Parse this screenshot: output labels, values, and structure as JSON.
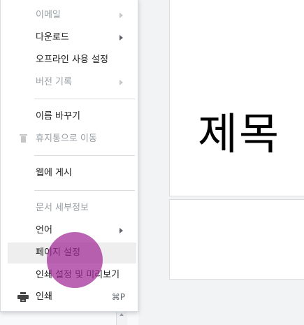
{
  "slide": {
    "title": "제목"
  },
  "menu": {
    "email": "이메일",
    "download": "다운로드",
    "offline": "오프라인 사용 설정",
    "version_history": "버전 기록",
    "rename": "이름 바꾸기",
    "move_to_trash": "휴지통으로 이동",
    "publish_web": "웹에 게시",
    "doc_details": "문서 세부정보",
    "language": "언어",
    "page_setup": "페이지 설정",
    "print_preview": "인쇄 설정 및 미리보기",
    "print": "인쇄",
    "print_shortcut": "⌘P"
  },
  "colors": {
    "highlight_bg": "#eeeeee",
    "disabled_text": "#9aa0a6",
    "click_indicator": "#a02896"
  }
}
